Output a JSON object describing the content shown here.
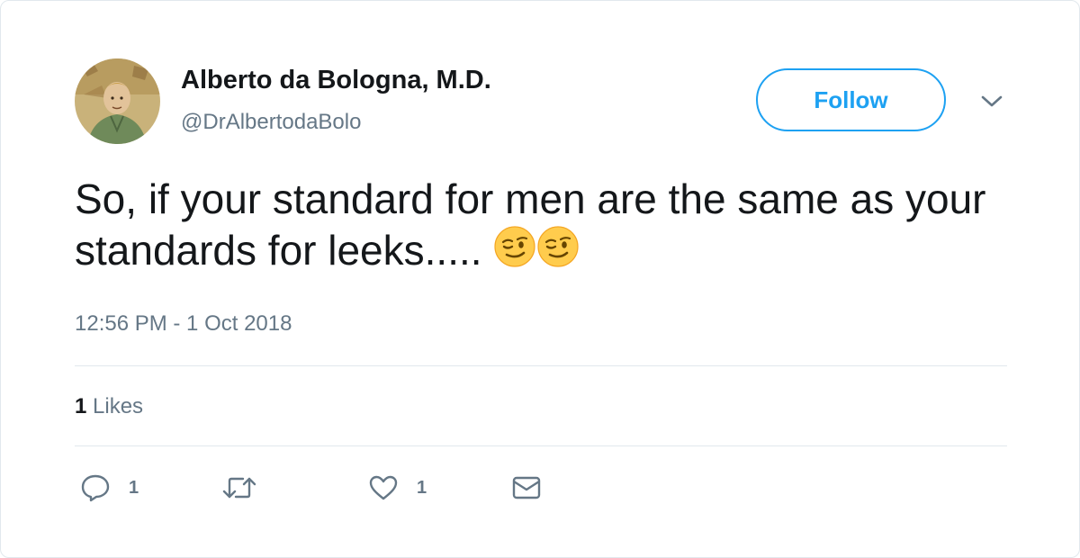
{
  "author": {
    "display_name": "Alberto da Bologna, M.D.",
    "handle": "@DrAlbertodaBolo"
  },
  "follow_button": {
    "label": "Follow"
  },
  "tweet": {
    "text": "So, if your standard for men are the same as your standards for leeks.....",
    "emojis": [
      "winking-face",
      "winking-face"
    ],
    "timestamp": "12:56 PM - 1 Oct 2018"
  },
  "stats": {
    "likes_count": "1",
    "likes_label": "Likes"
  },
  "actions": {
    "reply_count": "1",
    "like_count": "1"
  },
  "colors": {
    "accent": "#1da1f2",
    "secondary_text": "#657786",
    "divider": "#e1e8ed"
  }
}
